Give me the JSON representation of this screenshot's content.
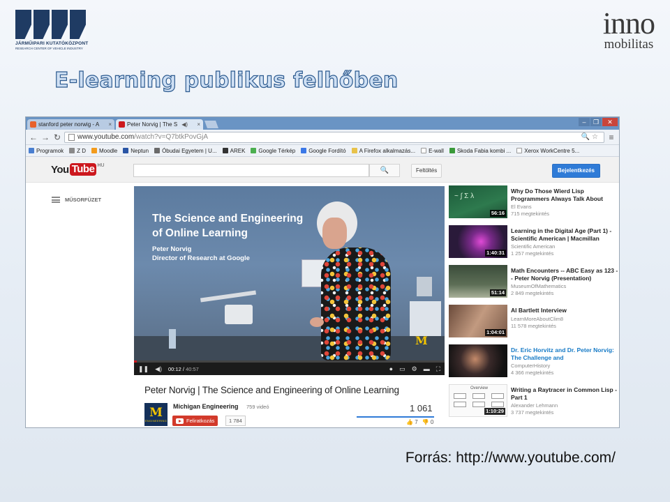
{
  "slide": {
    "title": "E-learning publikus felhőben",
    "source": "Forrás: http://www.youtube.com/",
    "logo_left": {
      "line1": "JÁRMŰIPARI KUTATÓKÖZPONT",
      "line2": "RESEARCH CENTER OF VEHICLE INDUSTRY"
    },
    "logo_right": {
      "line1": "inno",
      "line2": "mobilitas"
    }
  },
  "browser": {
    "tabs": [
      {
        "label": "stanford peter norwig - A",
        "active": false
      },
      {
        "label": "Peter Norvig | The S",
        "active": true
      }
    ],
    "window_controls": [
      "–",
      "❐",
      "✕"
    ],
    "url_host": "www.youtube.com",
    "url_path": "/watch?v=Q7btkPovGjA",
    "bookmarks": [
      "Programok",
      "Z D",
      "Moodle",
      "Neptun",
      "Óbudai Egyetem | U...",
      "AREK",
      "Google Térkép",
      "Google Fordító",
      "A Firefox alkalmazás...",
      "E-wall",
      "Skoda Fabia kombi ...",
      "Xerox WorkCentre 5..."
    ]
  },
  "youtube": {
    "logo_you": "You",
    "logo_tube": "Tube",
    "logo_region": "HU",
    "upload_label": "Feltöltés",
    "signin_label": "Bejelentkezés",
    "guide_label": "MŰSORFÜZET",
    "player": {
      "overlay_title": "The Science and Engineering of Online Learning",
      "overlay_name": "Peter Norvig",
      "overlay_role": "Director of Research at Google",
      "time_current": "00:12",
      "time_total": "40:57",
      "progress": 0.005,
      "corner_logo": "M"
    },
    "video": {
      "title": "Peter Norvig | The Science and Engineering of Online Learning",
      "channel": "Michigan Engineering",
      "channel_videos": "759 videó",
      "subscribe_label": "Feliratkozás",
      "subscriber_count": "1 784",
      "views": "1 061",
      "likes": "7",
      "dislikes": "0",
      "avatar_letter": "M",
      "avatar_text": "ENGINEERING"
    },
    "related": [
      {
        "title": "Why Do Those Wierd Lisp Programmers Always Talk About",
        "channel": "El Evans",
        "views": "715 megtekintés",
        "duration": "56:16",
        "title_color": "default"
      },
      {
        "title": "Learning in the Digital Age (Part 1) - Scientific American | Macmillan",
        "channel": "Scientific American",
        "views": "1 257 megtekintés",
        "duration": "1:40:31",
        "title_color": "default"
      },
      {
        "title": "Math Encounters -- ABC Easy as 123 -- Peter Norvig (Presentation)",
        "channel": "MuseumOfMathematics",
        "views": "2 849 megtekintés",
        "duration": "51:14",
        "title_color": "default"
      },
      {
        "title": "Al Bartlett Interview",
        "channel": "LearnMoreAboutClim8",
        "views": "11 578 megtekintés",
        "duration": "1:04:01",
        "title_color": "default"
      },
      {
        "title": "Dr. Eric Horvitz and Dr. Peter Norvig: The Challenge and",
        "channel": "ComputerHistory",
        "views": "4 366 megtekintés",
        "duration": "",
        "title_color": "blue"
      },
      {
        "title": "Writing a Raytracer in Common Lisp - Part 1",
        "channel": "Alexander Lehmann",
        "views": "3 737 megtekintés",
        "duration": "1:10:29",
        "title_color": "default",
        "thumb_label": "Overview"
      }
    ]
  }
}
